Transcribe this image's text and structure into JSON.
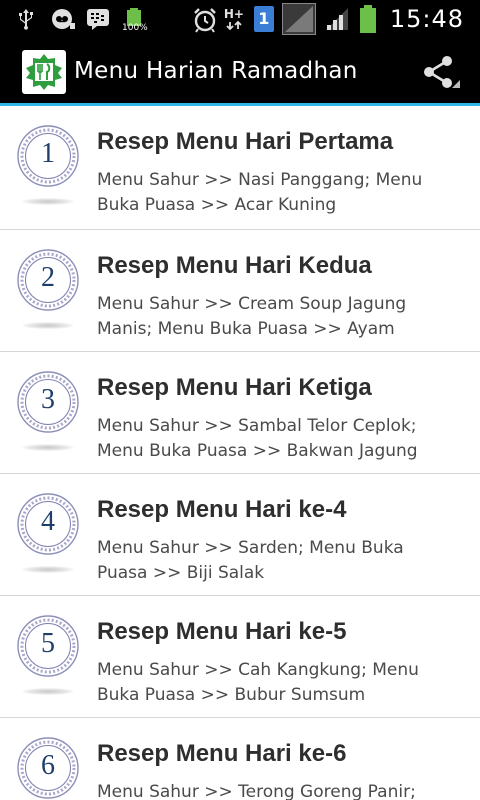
{
  "status_bar": {
    "icons": [
      "usb-icon",
      "voicemail-icon",
      "bbm-icon",
      "battery-full-icon",
      "alarm-icon",
      "h-plus-data-icon",
      "sim-1-icon",
      "no-signal-icon",
      "signal-icon",
      "battery-icon"
    ],
    "battery_label": "100%",
    "network_label": "H+",
    "sim_label": "1",
    "time": "15:48"
  },
  "action_bar": {
    "title": "Menu Harian Ramadhan",
    "logo_icon": "app-logo-icon",
    "share_icon": "share-icon",
    "accent_color": "#33b5e5"
  },
  "list": {
    "items": [
      {
        "number": "1",
        "title": "Resep Menu Hari Pertama",
        "desc": "Menu Sahur >> Nasi Panggang; Menu Buka Puasa >> Acar Kuning"
      },
      {
        "number": "2",
        "title": "Resep Menu Hari Kedua",
        "desc": "Menu Sahur >> Cream Soup Jagung Manis; Menu Buka Puasa >> Ayam"
      },
      {
        "number": "3",
        "title": "Resep Menu Hari Ketiga",
        "desc": "Menu Sahur >> Sambal Telor Ceplok; Menu Buka Puasa >> Bakwan Jagung"
      },
      {
        "number": "4",
        "title": "Resep Menu Hari ke-4",
        "desc": "Menu Sahur >> Sarden; Menu Buka Puasa >> Biji Salak"
      },
      {
        "number": "5",
        "title": "Resep Menu Hari ke-5",
        "desc": "Menu Sahur >> Cah Kangkung; Menu Buka Puasa >> Bubur Sumsum"
      },
      {
        "number": "6",
        "title": "Resep Menu Hari ke-6",
        "desc": "Menu Sahur >> Terong Goreng Panir;"
      }
    ]
  }
}
